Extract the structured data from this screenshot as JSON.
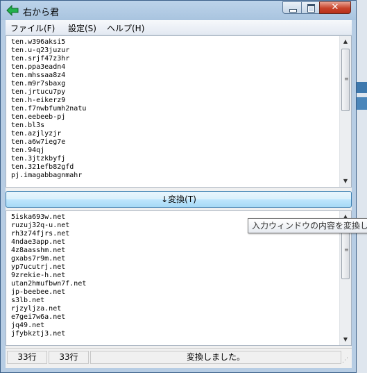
{
  "window": {
    "title": "右から君"
  },
  "menu": [
    "ファイル(F)",
    "設定(S)",
    "ヘルプ(H)"
  ],
  "input_lines": [
    "ten.w396aksi5",
    "ten.u-q23juzur",
    "ten.srjf47z3hr",
    "ten.ppa3eadn4",
    "ten.mhssaa8z4",
    "ten.m9r7sbaxg",
    "ten.jrtucu7py",
    "ten.h-eikerz9",
    "ten.f7nwbfumh2natu",
    "ten.eebeeb-pj",
    "ten.bl3s",
    "ten.azjlyzjr",
    "ten.a6w7ieg7e",
    "ten.94qj",
    "ten.3jtzkbyfj",
    "ten.321efb82gfd",
    "pj.imagabbagnmahr"
  ],
  "convert_button": "↓変換(T)",
  "output_lines": [
    "5iska693w.net",
    "ruzuj32q-u.net",
    "rh3z74fjrs.net",
    "4ndae3app.net",
    "4z8aasshm.net",
    "gxabs7r9m.net",
    "yp7ucutrj.net",
    "9zrekie-h.net",
    "utan2hmufbwn7f.net",
    "jp-beebee.net",
    "s3lb.net",
    "rjzyljza.net",
    "e7gei7w6a.net",
    "jq49.net",
    "jfybkztj3.net"
  ],
  "status": {
    "input_count": "33行",
    "output_count": "33行",
    "message": "変換しました。"
  },
  "tooltip": "入力ウィンドウの内容を変換し"
}
